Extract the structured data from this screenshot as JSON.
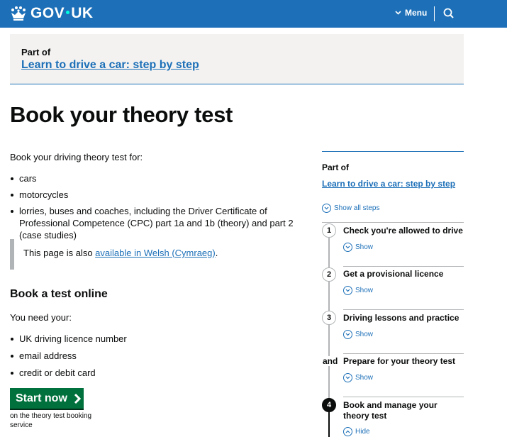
{
  "header": {
    "logo_part1": "GOV",
    "logo_part2": "UK",
    "menu_label": "Menu",
    "search_icon": "search-icon",
    "brand_color": "#1d70b8"
  },
  "part_of": {
    "label": "Part of",
    "link": "Learn to drive a car: step by step"
  },
  "page_title": "Book your theory test",
  "intro": "Book your driving theory test for:",
  "vehicles": [
    "cars",
    "motorcycles",
    "lorries, buses and coaches, including the Driver Certificate of Professional Competence (CPC) part 1a and 1b (theory) and part 2 (case studies)"
  ],
  "inset": {
    "text": "This page is also ",
    "link": "available in Welsh (Cymraeg)",
    "suffix": "."
  },
  "online": {
    "heading": "Book a test online",
    "need": "You need your:",
    "items": [
      "UK driving licence number",
      "email address",
      "credit or debit card"
    ],
    "start_label": "Start now",
    "start_note": "on the theory test booking service",
    "button_color": "#00703c"
  },
  "step_nav": {
    "part_of_label": "Part of",
    "link": "Learn to drive a car: step by step",
    "show_all": "Show all steps",
    "steps": [
      {
        "marker": "1",
        "title": "Check you're allowed to drive",
        "toggle": "Show"
      },
      {
        "marker": "2",
        "title": "Get a provisional licence",
        "toggle": "Show"
      },
      {
        "marker": "3",
        "title": "Driving lessons and practice",
        "toggle": "Show"
      },
      {
        "marker": "and",
        "title": "Prepare for your theory test",
        "toggle": "Show"
      },
      {
        "marker": "4",
        "title": "Book and manage your theory test",
        "toggle": "Hide"
      }
    ]
  }
}
